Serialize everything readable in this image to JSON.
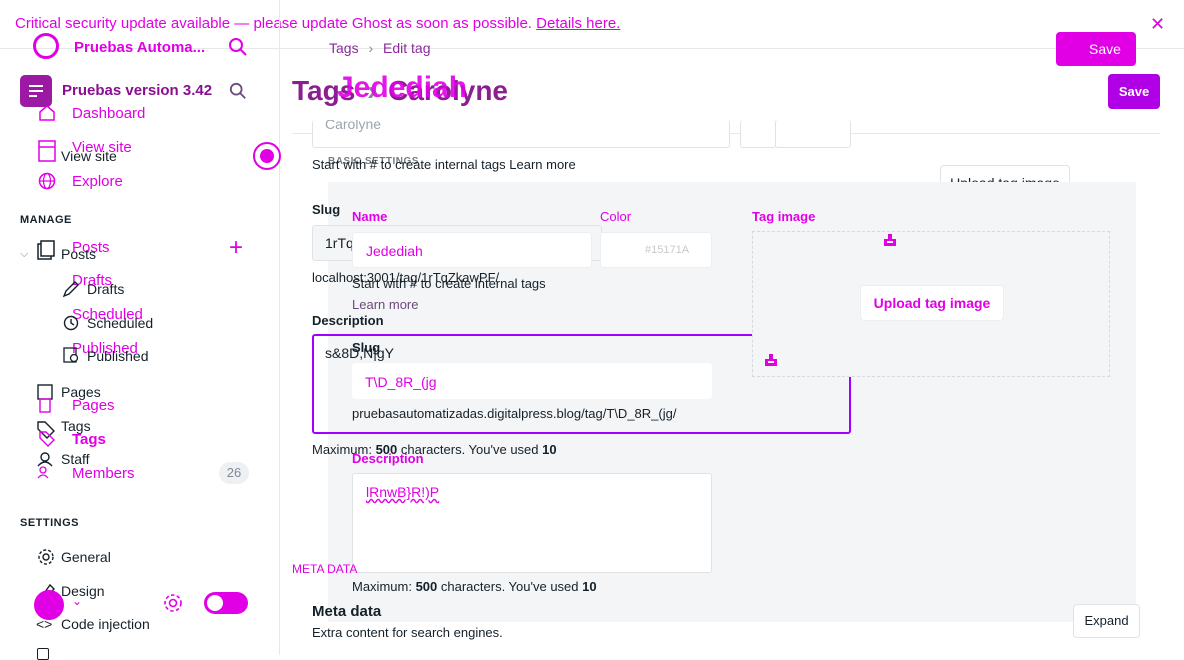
{
  "banner": {
    "text": "Critical security update available — please update Ghost as soon as possible.",
    "link": "Details here."
  },
  "brand": {
    "site_name_a": "Pruebas Automa...",
    "site_name_b": "Pruebas version 3.42"
  },
  "breadcrumb": {
    "root": "Tags",
    "separator": "›",
    "current": "Edit tag"
  },
  "header": {
    "title_a": "Tags",
    "title_sep": "›",
    "title_b": "Carolyne",
    "title_overlay": "Jedediah",
    "save_a": "Save",
    "save_b": "Save"
  },
  "nav": {
    "dashboard": "Dashboard",
    "view_site_a": "View site",
    "view_site_b": "View site",
    "explore": "Explore",
    "manage_heading": "MANAGE",
    "posts_a": "Posts",
    "posts_b": "Posts",
    "drafts_a": "Drafts",
    "drafts_b": "Drafts",
    "scheduled_a": "Scheduled",
    "scheduled_b": "Scheduled",
    "published_a": "Published",
    "published_b": "Published",
    "pages_a": "Pages",
    "pages_b": "Pages",
    "tags_a": "Tags",
    "tags_b": "Tags",
    "staff": "Staff",
    "members": "Members",
    "members_count": "26",
    "settings_heading": "SETTINGS",
    "general": "General",
    "design": "Design",
    "code_injection": "Code injection"
  },
  "form_back": {
    "name_value": "Carolyne",
    "name_hint": "Start with # to create internal tags Learn more",
    "slug_label": "Slug",
    "slug_value": "1rTqZkawPF",
    "slug_url": "localhost:3001/tag/1rTqZkawPF/",
    "description_label": "Description",
    "description_value": "s&8D,N|gY",
    "description_hint_prefix": "Maximum: ",
    "description_hint_max": "500",
    "description_hint_mid": " characters. You've used ",
    "description_hint_used": "10",
    "basic_settings": "BASIC SETTINGS",
    "meta_data_heading": "META DATA",
    "meta_title": "Meta data",
    "meta_subtitle": "Extra content for search engines.",
    "expand": "Expand",
    "upload": "Upload tag image"
  },
  "form_front": {
    "name_label": "Name",
    "name_value": "Jedediah",
    "color_label": "Color",
    "color_value": "#15171A",
    "image_label": "Tag image",
    "name_hint": "Start with # to create internal tags",
    "learn_more": "Learn more",
    "upload": "Upload tag image",
    "slug_label": "Slug",
    "slug_value": "T\\D_8R_(jg",
    "slug_url": "pruebasautomatizadas.digitalpress.blog/tag/T\\D_8R_(jg/",
    "description_label": "Description",
    "description_value": "lRnwB}R!)P",
    "description_hint_prefix": "Maximum: ",
    "description_hint_max": "500",
    "description_hint_mid": " characters. You've used ",
    "description_hint_used": "10"
  },
  "colors": {
    "accent": "#e100e6",
    "save_bg": "#a100ff"
  }
}
